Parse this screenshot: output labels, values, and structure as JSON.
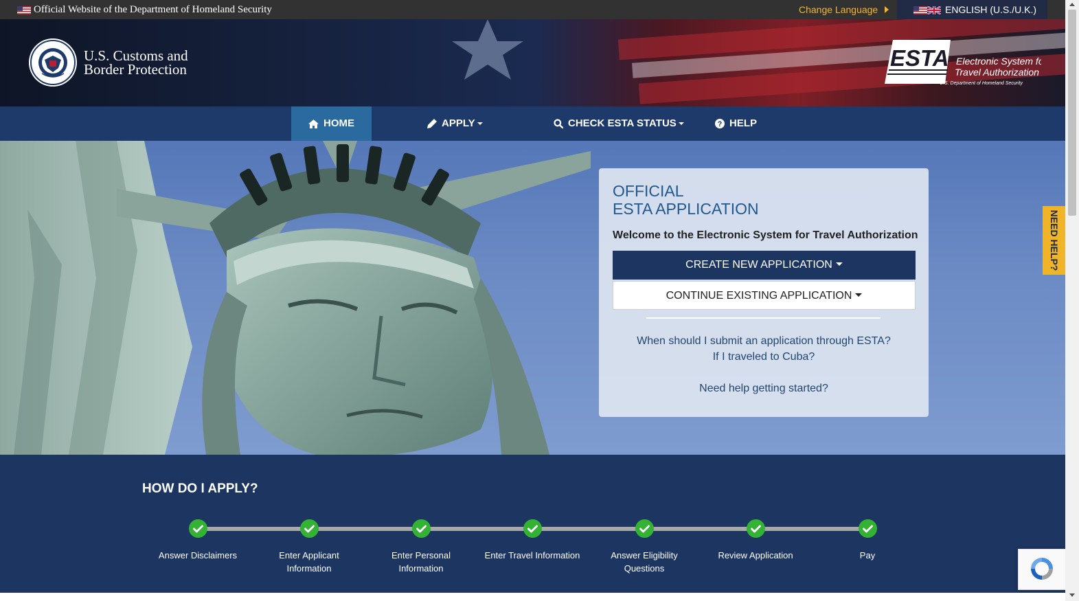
{
  "gov_bar": {
    "official_text": "Official Website of the Department of Homeland Security",
    "change_language": "Change Language",
    "current_language": "ENGLISH (U.S./U.K.)"
  },
  "header": {
    "agency_line1": "U.S. Customs and",
    "agency_line2": "Border Protection",
    "esta_logo_text": "ESTA",
    "esta_logo_line1": "Electronic System for",
    "esta_logo_line2": "Travel Authorization",
    "esta_logo_dept": "U.S. Department of Homeland Security"
  },
  "nav": {
    "items": [
      {
        "label": "HOME",
        "icon": "home-icon",
        "active": true
      },
      {
        "label": "APPLY",
        "icon": "pencil-icon",
        "dropdown": true
      },
      {
        "label": "CHECK ESTA STATUS",
        "icon": "search-icon",
        "dropdown": true
      },
      {
        "label": "HELP",
        "icon": "question-circle-icon"
      }
    ]
  },
  "card": {
    "title_line1": "OFFICIAL",
    "title_line2": "ESTA APPLICATION",
    "welcome": "Welcome to the Electronic System for Travel Authorization",
    "create_button": "CREATE NEW APPLICATION",
    "continue_button": "CONTINUE EXISTING APPLICATION",
    "link_when": "When should I submit an application through ESTA?",
    "link_cuba": "If I traveled to Cuba?",
    "link_help": "Need help getting started?"
  },
  "need_help_tab": "NEED HELP?",
  "how_to_apply": {
    "heading": "HOW DO I APPLY?",
    "steps": [
      {
        "label": "Answer Disclaimers"
      },
      {
        "label": "Enter Applicant Information"
      },
      {
        "label": "Enter Personal Information"
      },
      {
        "label": "Enter Travel Information"
      },
      {
        "label": "Answer Eligibility Questions"
      },
      {
        "label": "Review Application"
      },
      {
        "label": "Pay"
      }
    ]
  },
  "colors": {
    "nav_bg": "#1e3a6b",
    "nav_active": "#2a6a9e",
    "primary_button": "#1c3561",
    "accent_yellow": "#f0b429",
    "step_check": "#34b233"
  }
}
